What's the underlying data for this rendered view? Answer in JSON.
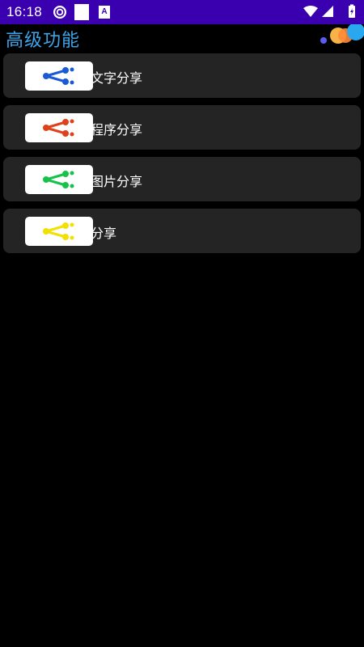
{
  "status_bar": {
    "time": "16:18",
    "app_icon_letter": "A",
    "background": "#3a00b0"
  },
  "header": {
    "title": "高级功能",
    "title_color": "#3da4ea"
  },
  "share_items": [
    {
      "label": "文字分享",
      "icon": "share-icon",
      "icon_color": "#1a5ad6"
    },
    {
      "label": "程序分享",
      "icon": "share-icon",
      "icon_color": "#e0401a"
    },
    {
      "label": "图片分享",
      "icon": "share-icon",
      "icon_color": "#16c24a"
    },
    {
      "label": "分享",
      "icon": "share-icon",
      "icon_color": "#f2e000"
    }
  ]
}
